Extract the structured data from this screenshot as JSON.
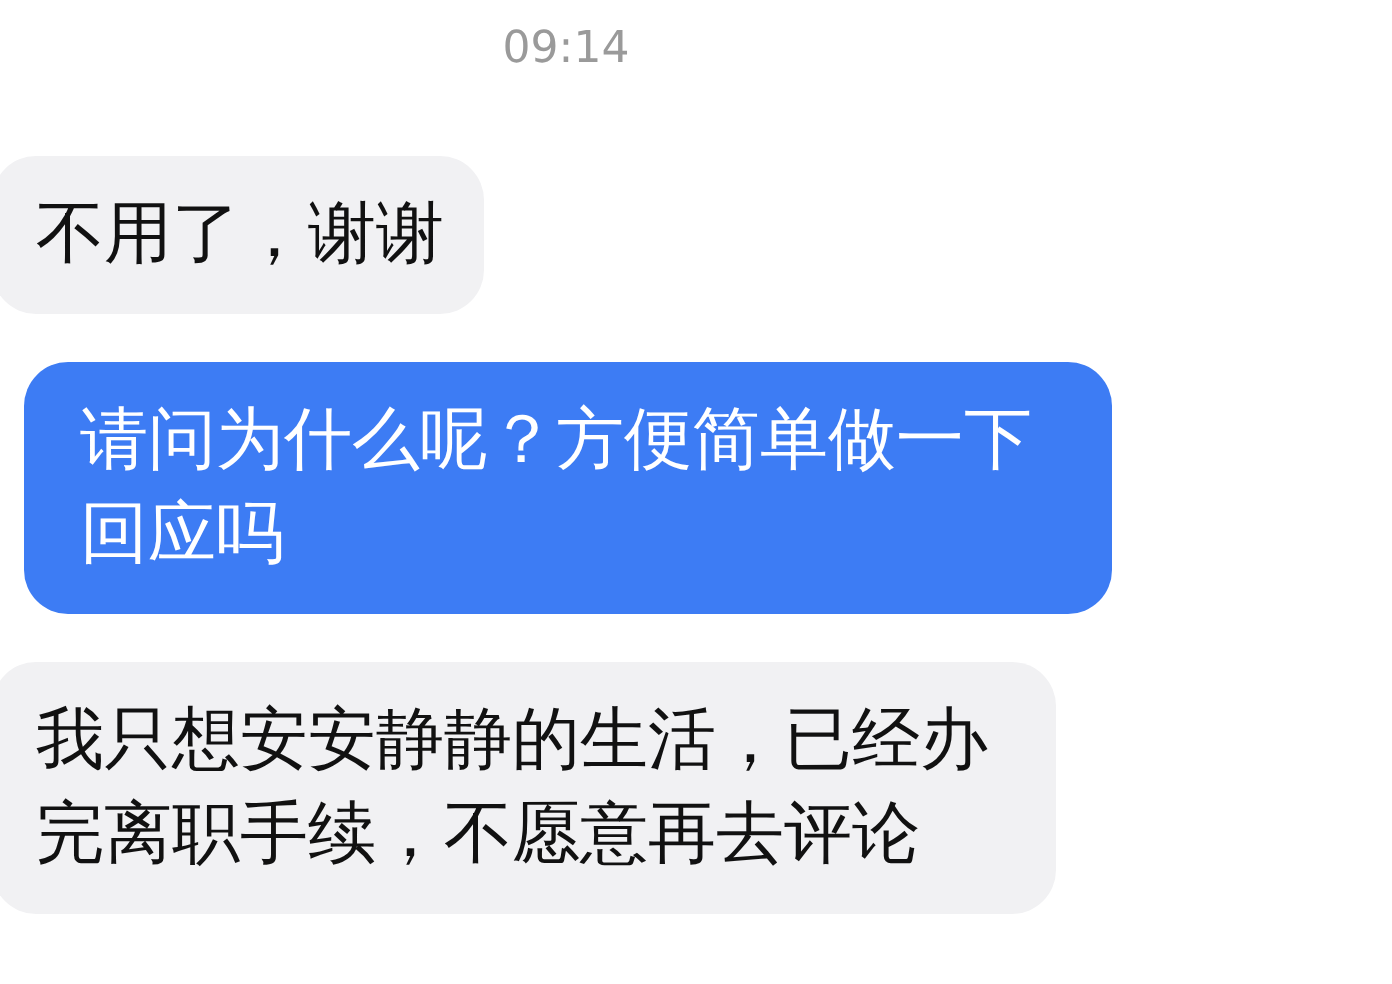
{
  "timestamp": "09:14",
  "messages": [
    {
      "kind": "received",
      "text": "不用了，谢谢"
    },
    {
      "kind": "sent",
      "text": "请问为什么呢？方便简单做一下回应吗"
    },
    {
      "kind": "received",
      "text": "我只想安安静静的生活，已经办完离职手续，不愿意再去评论"
    }
  ]
}
